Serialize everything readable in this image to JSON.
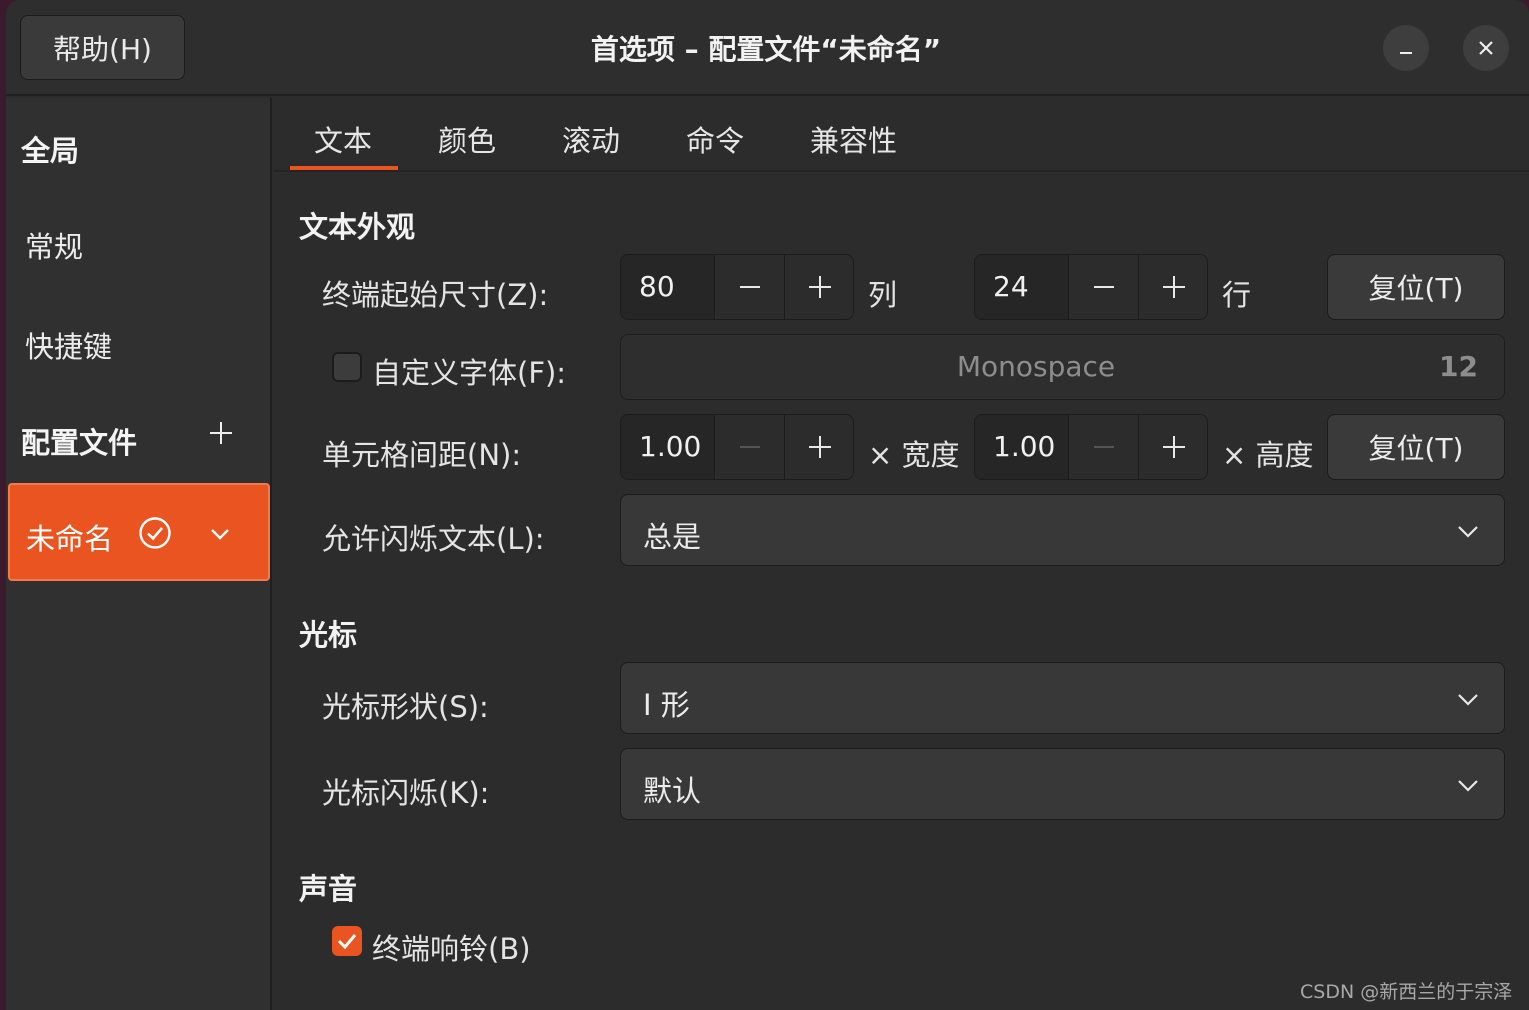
{
  "titlebar": {
    "help_label": "帮助(H)",
    "title": "首选项 – 配置文件“未命名”",
    "minimize_glyph": "–",
    "close_glyph": "✕"
  },
  "sidebar": {
    "global_header": "全局",
    "items": [
      {
        "label": "常规"
      },
      {
        "label": "快捷键"
      }
    ],
    "profiles_header": "配置文件",
    "profile": {
      "name": "未命名",
      "is_default": true
    }
  },
  "tabs": [
    {
      "label": "文本",
      "active": true
    },
    {
      "label": "颜色",
      "active": false
    },
    {
      "label": "滚动",
      "active": false
    },
    {
      "label": "命令",
      "active": false
    },
    {
      "label": "兼容性",
      "active": false
    }
  ],
  "text_appearance": {
    "title": "文本外观",
    "size": {
      "label": "终端起始尺寸(Z):",
      "columns": "80",
      "columns_unit": "列",
      "rows": "24",
      "rows_unit": "行",
      "reset_label": "复位(T)"
    },
    "custom_font": {
      "label": "自定义字体(F):",
      "checked": false,
      "font_name": "Monospace",
      "font_size": "12"
    },
    "cell_spacing": {
      "label": "单元格间距(N):",
      "width_value": "1.00",
      "width_unit": "× 宽度",
      "height_value": "1.00",
      "height_unit": "× 高度",
      "reset_label": "复位(T)"
    },
    "blink": {
      "label": "允许闪烁文本(L):",
      "value": "总是"
    }
  },
  "cursor": {
    "title": "光标",
    "shape": {
      "label": "光标形状(S):",
      "value": "I 形"
    },
    "blink": {
      "label": "光标闪烁(K):",
      "value": "默认"
    }
  },
  "sound": {
    "title": "声音",
    "bell": {
      "label": "终端响铃(B)",
      "checked": true
    }
  },
  "watermark": "CSDN @新西兰的于宗泽",
  "colors": {
    "accent": "#e95420",
    "window_bg": "#2c2c2c",
    "desktop_bg": "#3b1a2e"
  }
}
